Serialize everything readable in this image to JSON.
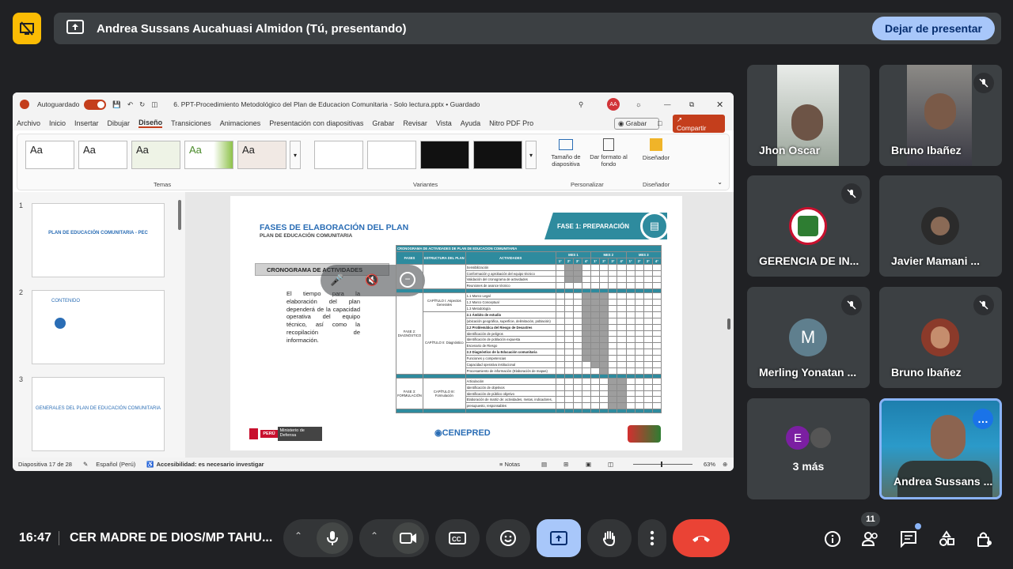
{
  "top_bar": {
    "presenter_text": "Andrea Sussans Aucahuasi Almidon (Tú, presentando)",
    "stop_button": "Dejar de presentar"
  },
  "ppt": {
    "autosave_label": "Autoguardado",
    "file_title": "6. PPT-Procedimiento Metodológico del Plan de Educacion Comunitaria - Solo lectura.pptx • Guardado",
    "avatar_initials": "AA",
    "menu": [
      "Archivo",
      "Inicio",
      "Insertar",
      "Dibujar",
      "Diseño",
      "Transiciones",
      "Animaciones",
      "Presentación con diapositivas",
      "Grabar",
      "Revisar",
      "Vista",
      "Ayuda",
      "Nitro PDF Pro"
    ],
    "record_label": "Grabar",
    "share_label": "Compartir",
    "ribbon": {
      "themes_label": "Temas",
      "variants_label": "Variantes",
      "theme_sample": "Aa",
      "slide_size": "Tamaño de diapositiva",
      "format_bg": "Dar formato al fondo",
      "customize": "Personalizar",
      "designer": "Diseñador",
      "designer_group": "Diseñador"
    },
    "thumbnails": [
      {
        "num": "1",
        "title": "PLAN DE EDUCACIÓN COMUNITARIA - PEC"
      },
      {
        "num": "2",
        "title": "CONTENIDO"
      },
      {
        "num": "3",
        "title": "GENERALES DEL PLAN DE EDUCACIÓN COMUNITARIA"
      }
    ],
    "status": {
      "slide_count": "Diapositiva 17 de 28",
      "language": "Español (Perú)",
      "accessibility": "Accesibilidad: es necesario investigar",
      "notes": "Notas",
      "zoom": "63%"
    }
  },
  "slide": {
    "title": "FASES DE ELABORACIÓN DEL PLAN",
    "subtitle": "PLAN DE EDUCACIÓN COMUNITARIA",
    "phase_badge": "FASE 1: PREPARACIÓN",
    "section": "CRONOGRAMA DE ACTIVIDADES",
    "body": "El tiempo para la elaboración del plan dependerá de la capacidad operativa del equipo técnico, así como la recopilación de información.",
    "table_title": "CRONOGRAMA DE  ACTIVIDADES DE PLAN DE EDUCACION COMUNITARIA",
    "col_fases": "FASES",
    "col_estructura": "ESTRUCTURA DEL PLAN",
    "col_actividades": "ACTIVIDADES",
    "months": [
      "MES 1",
      "MES 2",
      "MES 3"
    ],
    "weeks": [
      "1°",
      "2°",
      "3°",
      "4°"
    ],
    "phase_labels": [
      "FASE 2: DIAGNÓSTICO",
      "FASE 3: FORMULACIÓN"
    ],
    "chapter_labels": [
      "CAPÍTULO I: Aspectos Generales",
      "CAPÍTULO II: Diagnóstico",
      "CAPÍTULO III: Formulación"
    ],
    "activities": [
      "Sensibilización",
      "Conformación y aprobación del equipo técnico",
      "Validación del cronograma de actividades",
      "Reuniones de avance técnico",
      "1.1 Marco Legal",
      "1.2 Marco Conceptual",
      "1.3 Metodología",
      "2.1  Ámbito de estudio",
      "(ubicación geográfica, superficie, delimitación, población)",
      "2.2 Problemática del Riesgo de Desastres",
      "Identificación de peligros",
      "Identificación de población expuesta",
      "Escenario de Riesgo",
      "2.3  Diagnóstico de la Educación comunitaria",
      "Funciones y competencias",
      "Capacidad operativa institucional",
      "Procesamiento de información (Elaboración de mapas)",
      "Articulación",
      "Identificación de objetivos",
      "Identificación de público objetivo",
      "Elaboración de matriz de: actividades, metas, indicadores,",
      "presupuesto, responsables"
    ],
    "footer_ministry": "Ministerio de Defensa",
    "footer_peru": "PERÚ",
    "footer_logo": "CENEPRED"
  },
  "participants": [
    {
      "name": "Jhon Oscar",
      "muted": false
    },
    {
      "name": "Bruno Ibañez",
      "muted": true
    },
    {
      "name": "GERENCIA DE IN...",
      "muted": true
    },
    {
      "name": "Javier Mamani ...",
      "muted": false
    },
    {
      "name": "Merling Yonatan ...",
      "muted": true,
      "initial": "M",
      "color": "#5f7f8e"
    },
    {
      "name": "Bruno Ibañez",
      "muted": true
    },
    {
      "name": "3 más",
      "initial": "E",
      "color": "#7b1fa2"
    },
    {
      "name": "Andrea Sussans ..."
    }
  ],
  "bottom_bar": {
    "time": "16:47",
    "meeting_name": "CER MADRE DE DIOS/MP TAHU...",
    "people_count": "11"
  },
  "colors": {
    "accent": "#a8c7fa",
    "end_call": "#ea4335",
    "present_active": "#a8c7fa",
    "warning": "#fbbc04",
    "slide_teal": "#2e8b9e"
  }
}
